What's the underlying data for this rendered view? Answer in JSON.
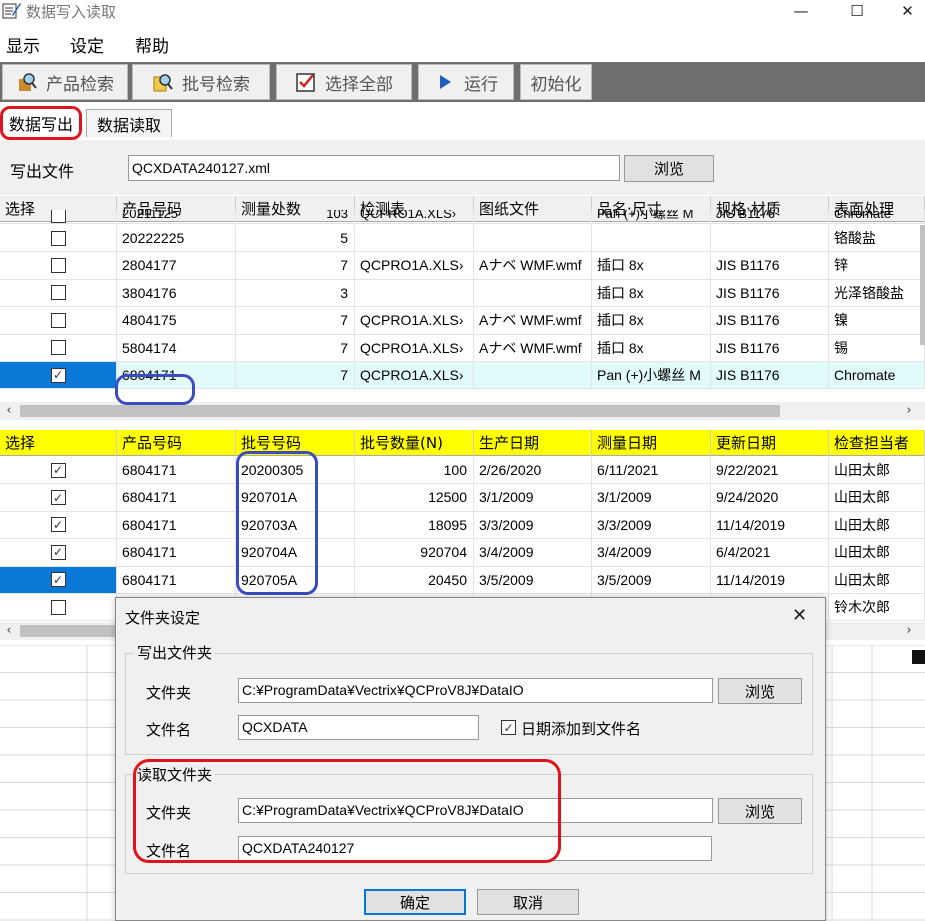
{
  "window": {
    "title": "数据写入读取",
    "minimize": "—",
    "maximize": "☐",
    "close": "✕"
  },
  "menu": [
    "显示",
    "设定",
    "帮助"
  ],
  "toolbar": [
    {
      "label": "产品检索",
      "icon": "product-search-icon"
    },
    {
      "label": "批号检索",
      "icon": "lot-search-icon"
    },
    {
      "label": "选择全部",
      "icon": "select-all-icon"
    },
    {
      "label": "运行",
      "icon": "run-play-icon"
    },
    {
      "label": "初始化",
      "icon": ""
    }
  ],
  "tabs": {
    "active": "数据写出",
    "other": "数据读取"
  },
  "export": {
    "label": "写出文件",
    "value": "QCXDATA240127.xml",
    "browse": "浏览"
  },
  "grid1": {
    "headers": [
      "选择",
      "产品号码",
      "测量处数",
      "检测表",
      "图纸文件",
      "品名·尺寸",
      "规格·材质",
      "表面处理"
    ],
    "partial_row": [
      "20211125",
      "103",
      "QCPRO1A.XLS›",
      "",
      "Pan (+)小螺丝 M",
      "JIS B1176",
      "Chromate"
    ],
    "rows": [
      {
        "checked": false,
        "product": "20222225",
        "count": "5",
        "sheet": "",
        "drawing": "",
        "name": "",
        "spec": "",
        "surface": "铬酸盐"
      },
      {
        "checked": false,
        "product": "2804177",
        "count": "7",
        "sheet": "QCPRO1A.XLS›",
        "drawing": "Aナベ WMF.wmf",
        "name": "插口 8x",
        "spec": "JIS B1176",
        "surface": "锌"
      },
      {
        "checked": false,
        "product": "3804176",
        "count": "3",
        "sheet": "",
        "drawing": "",
        "name": "插口 8x",
        "spec": "JIS B1176",
        "surface": "光泽铬酸盐"
      },
      {
        "checked": false,
        "product": "4804175",
        "count": "7",
        "sheet": "QCPRO1A.XLS›",
        "drawing": "Aナベ WMF.wmf",
        "name": "插口 8x",
        "spec": "JIS B1176",
        "surface": "镍"
      },
      {
        "checked": false,
        "product": "5804174",
        "count": "7",
        "sheet": "QCPRO1A.XLS›",
        "drawing": "Aナベ WMF.wmf",
        "name": "插口 8x",
        "spec": "JIS B1176",
        "surface": "锡"
      },
      {
        "checked": true,
        "product": "6804171",
        "count": "7",
        "sheet": "QCPRO1A.XLS›",
        "drawing": "",
        "name": "Pan (+)小螺丝 M",
        "spec": "JIS B1176",
        "surface": "Chromate"
      }
    ]
  },
  "grid2": {
    "headers": [
      "选择",
      "产品号码",
      "批号号码",
      "批号数量(N)",
      "生产日期",
      "测量日期",
      "更新日期",
      "检查担当者"
    ],
    "rows": [
      {
        "checked": true,
        "product": "6804171",
        "lot": "20200305",
        "qty": "100",
        "prod_date": "2/26/2020",
        "meas_date": "6/11/2021",
        "upd_date": "9/22/2021",
        "inspector": "山田太郎"
      },
      {
        "checked": true,
        "product": "6804171",
        "lot": "920701A",
        "qty": "12500",
        "prod_date": "3/1/2009",
        "meas_date": "3/1/2009",
        "upd_date": "9/24/2020",
        "inspector": "山田太郎"
      },
      {
        "checked": true,
        "product": "6804171",
        "lot": "920703A",
        "qty": "18095",
        "prod_date": "3/3/2009",
        "meas_date": "3/3/2009",
        "upd_date": "11/14/2019",
        "inspector": "山田太郎"
      },
      {
        "checked": true,
        "product": "6804171",
        "lot": "920704A",
        "qty": "920704",
        "prod_date": "3/4/2009",
        "meas_date": "3/4/2009",
        "upd_date": "6/4/2021",
        "inspector": "山田太郎"
      },
      {
        "checked": true,
        "product": "6804171",
        "lot": "920705A",
        "qty": "20450",
        "prod_date": "3/5/2009",
        "meas_date": "3/5/2009",
        "upd_date": "11/14/2019",
        "inspector": "山田太郎"
      },
      {
        "checked": false,
        "product": "",
        "lot": "",
        "qty": "",
        "prod_date": "",
        "meas_date": "",
        "upd_date": "",
        "inspector": "铃木次郎"
      }
    ]
  },
  "dialog": {
    "title": "文件夹设定",
    "close": "✕",
    "export_group": {
      "legend": "写出文件夹",
      "folder_label": "文件夹",
      "folder_value": "C:¥ProgramData¥Vectrix¥QCProV8J¥DataIO",
      "browse": "浏览",
      "name_label": "文件名",
      "name_value": "QCXDATA",
      "date_checkbox_label": "日期添加到文件名",
      "date_checkbox_checked": true
    },
    "import_group": {
      "legend": "读取文件夹",
      "folder_label": "文件夹",
      "folder_value": "C:¥ProgramData¥Vectrix¥QCProV8J¥DataIO",
      "browse": "浏览",
      "name_label": "文件名",
      "name_value": "QCXDATA240127"
    },
    "ok": "确定",
    "cancel": "取消"
  },
  "colors": {
    "toolbar_bg": "#6e6e6e",
    "grid2_header": "#ffff00",
    "selected_blue": "#0a78d7",
    "highlight_red": "#e0141e",
    "highlight_blue": "#3b4cc0",
    "selected_row": "#e1fbfb"
  }
}
